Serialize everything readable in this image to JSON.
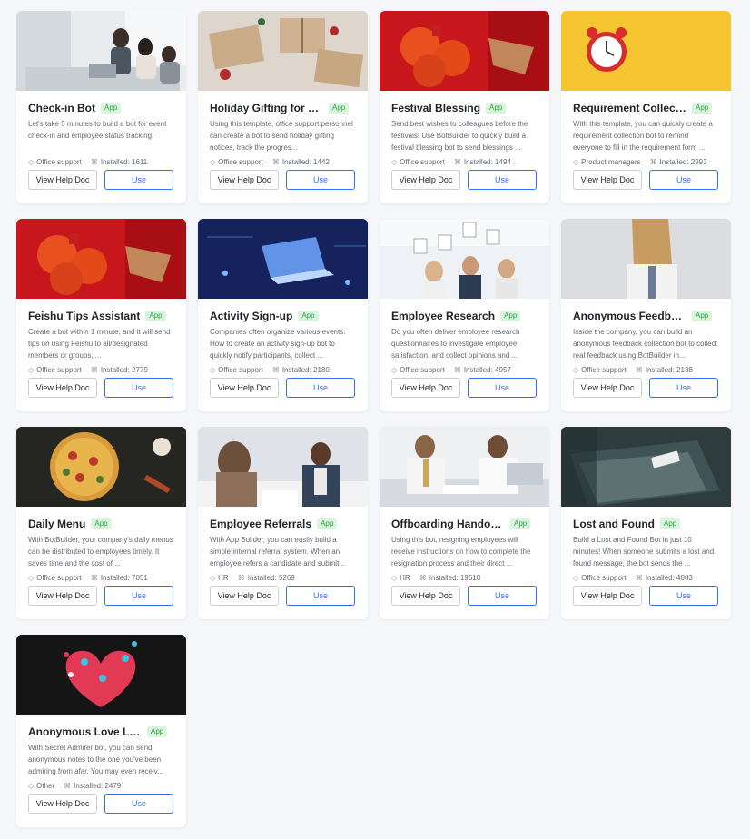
{
  "labels": {
    "badge": "App",
    "help_button": "View Help Doc",
    "use_button": "Use",
    "installed_prefix": "Installed: "
  },
  "cards": [
    {
      "title": "Check-in Bot",
      "desc": "Let's take 5 minutes to build a bot for event check-in and employee status tracking!",
      "category": "Office support",
      "installed": "1611",
      "image": "office-meeting-photo"
    },
    {
      "title": "Holiday Gifting for Empl...",
      "desc": "Using this template, office support personnel can create a bot to send holiday gifting notices, track the progres...",
      "category": "Office support",
      "installed": "1442",
      "image": "wrapped-gifts-photo"
    },
    {
      "title": "Festival Blessing",
      "desc": "Send best wishes to colleagues before the festivals! Use BotBuilder to quickly build a festival blessing bot to send blessings ...",
      "category": "Office support",
      "installed": "1494",
      "image": "festival-oranges-photo"
    },
    {
      "title": "Requirement Collection",
      "desc": "With this template, you can quickly create a requirement collection bot to remind everyone to fill in the requirement form ...",
      "category": "Product managers",
      "installed": "2993",
      "image": "alarm-clock-photo"
    },
    {
      "title": "Feishu Tips Assistant",
      "desc": "Create a bot within 1 minute, and it will send tips on using Feishu to all/designated members or groups, ...",
      "category": "Office support",
      "installed": "2779",
      "image": "festival-oranges-photo"
    },
    {
      "title": "Activity Sign-up",
      "desc": "Companies often organize various events. How to create an activity sign-up bot to quickly notify participants, collect ...",
      "category": "Office support",
      "installed": "2180",
      "image": "digital-laptop-photo"
    },
    {
      "title": "Employee Research",
      "desc": "Do you often deliver employee research questionnaires to investigate employee satisfaction, and collect opinions and ...",
      "category": "Office support",
      "installed": "4957",
      "image": "raised-number-cards-photo"
    },
    {
      "title": "Anonymous Feedback",
      "desc": "Inside the company, you can build an anonymous feedback collection bot to collect real feedback using BotBuilder in...",
      "category": "Office support",
      "installed": "2138",
      "image": "paper-bag-head-photo"
    },
    {
      "title": "Daily Menu",
      "desc": "With BotBuilder, your company's daily menus can be distributed to employees timely. It saves time and the cost of ...",
      "category": "Office support",
      "installed": "7051",
      "image": "pizza-photo"
    },
    {
      "title": "Employee Referrals",
      "desc": "With App Builder, you can easily build a simple internal referral system. When an employee refers a candidate and submit...",
      "category": "HR",
      "installed": "5269",
      "image": "interview-photo"
    },
    {
      "title": "Offboarding Handover",
      "desc": "Using this bot, resigning employees will receive instructions on how to complete the resignation process and their direct ...",
      "category": "HR",
      "installed": "19618",
      "image": "handover-meeting-photo"
    },
    {
      "title": "Lost and Found",
      "desc": "Build a Lost and Found Bot in just 10 minutes! When someone submits a lost and found message, the bot sends the ...",
      "category": "Office support",
      "installed": "4883",
      "image": "phone-on-chair-photo"
    },
    {
      "title": "Anonymous Love Letters",
      "desc": "With Secret Admirer bot, you can send anonymous notes to the one you've been admiring from afar. You may even receiv...",
      "category": "Other",
      "installed": "2479",
      "image": "heart-balloons-photo"
    }
  ]
}
